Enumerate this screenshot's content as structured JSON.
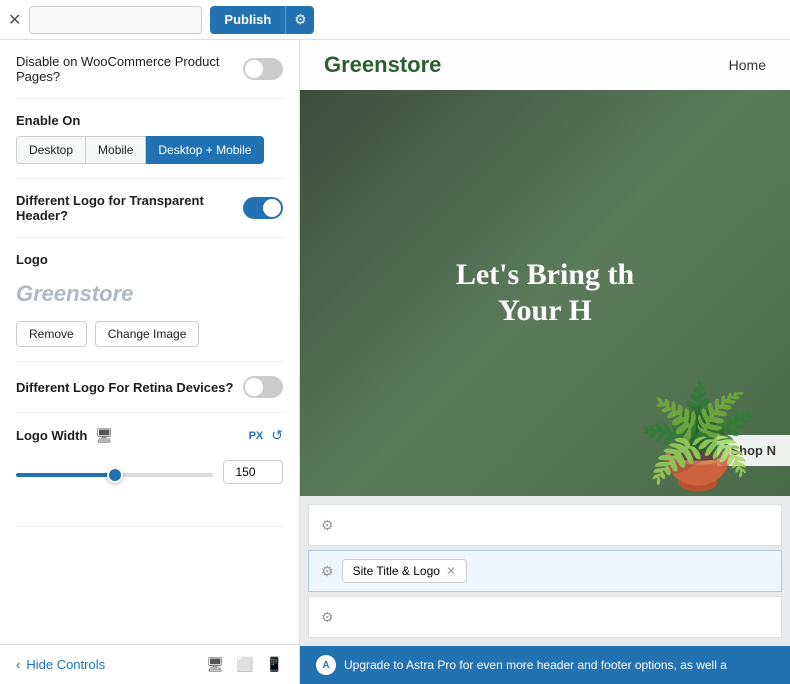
{
  "topbar": {
    "publish_label": "Publish",
    "gear_icon": "⚙",
    "close_icon": "✕",
    "search_placeholder": ""
  },
  "panel": {
    "sections": [
      {
        "id": "woocommerce",
        "label": "Disable on WooCommerce Product Pages?",
        "toggle": false
      },
      {
        "id": "enable_on",
        "label": "Enable On",
        "buttons": [
          "Desktop",
          "Mobile",
          "Desktop + Mobile"
        ],
        "active": "Desktop + Mobile"
      },
      {
        "id": "different_logo_transparent",
        "label": "Different Logo for Transparent Header?",
        "toggle": true
      },
      {
        "id": "logo",
        "label": "Logo",
        "preview_text": "Greenstore",
        "buttons": [
          "Remove",
          "Change Image"
        ]
      },
      {
        "id": "different_logo_retina",
        "label": "Different Logo For Retina Devices?",
        "toggle": false
      },
      {
        "id": "logo_width",
        "label": "Logo Width",
        "unit": "PX",
        "reset_icon": "↺",
        "value": 150,
        "min": 0,
        "max": 300,
        "slider_percent": 50
      }
    ]
  },
  "preview": {
    "site_title": "Greenstore",
    "nav_items": [
      "Home"
    ],
    "hero_text": "Let's Bring th Your H",
    "hero_button": "Shop N",
    "builder_rows": [
      {
        "id": "row1",
        "items": []
      },
      {
        "id": "row2",
        "items": [
          "Site Title & Logo"
        ]
      },
      {
        "id": "row3",
        "items": []
      }
    ]
  },
  "bottom": {
    "hide_controls_label": "Hide Controls",
    "arrow_icon": "‹",
    "monitor_icon": "🖥",
    "tablet_icon": "⬜",
    "mobile_icon": "📱"
  },
  "upgrade_bar": {
    "astra_logo": "A",
    "text": "Upgrade to Astra Pro for even more header and footer options, as well a"
  }
}
